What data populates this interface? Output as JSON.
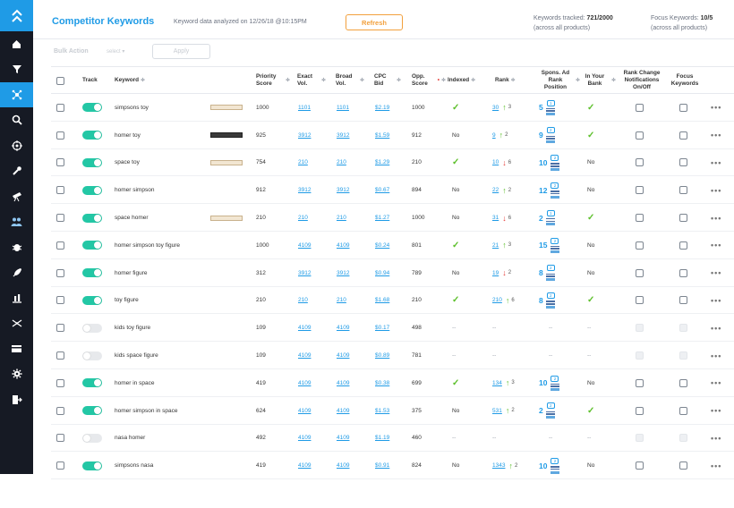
{
  "header": {
    "title": "Competitor Keywords",
    "analyzed": "Keyword data analyzed on 12/26/18 @10:15PM",
    "refresh_label": "Refresh",
    "tracked_label": "Keywords tracked:",
    "tracked_value": "721/2000",
    "tracked_sub": "(across all products)",
    "focus_label": "Focus Keywords:",
    "focus_value": "10/5",
    "focus_sub": "(across all products)"
  },
  "bulk": {
    "label": "Bulk Action",
    "select": "select ▾",
    "apply": "Apply"
  },
  "columns": {
    "track": "Track",
    "keyword": "Keyword",
    "priority": "Priority Score",
    "exact": "Exact Vol.",
    "broad": "Broad Vol.",
    "cpc": "CPC Bid",
    "opp": "Opp. Score",
    "indexed": "Indexed",
    "rank": "Rank",
    "spons": "Spons. Ad Rank Position",
    "bank": "In Your Bank",
    "notif": "Rank Change Notifications On/Off",
    "focus": "Focus Keywords"
  },
  "colors": {
    "accent": "#1f9be6",
    "toggle_on": "#23c7a5",
    "up": "#5cbf2a",
    "down": "#e53935",
    "refresh": "#f2a03d"
  },
  "rows": [
    {
      "track": true,
      "keyword": "simpsons toy",
      "thumb": "light",
      "priority": "1000",
      "exact": "1101",
      "broad": "1101",
      "cpc": "$2.19",
      "opp": "1000",
      "indexed": "check",
      "rank": "30",
      "dir": "up",
      "delta": "3",
      "spons": "5",
      "badge": "1",
      "bank": "check"
    },
    {
      "track": true,
      "keyword": "homer toy",
      "thumb": "dark",
      "priority": "925",
      "exact": "3912",
      "broad": "3912",
      "cpc": "$1.59",
      "opp": "912",
      "indexed": "No",
      "rank": "9",
      "dir": "up",
      "delta": "2",
      "spons": "9",
      "badge": "2",
      "bank": "check"
    },
    {
      "track": true,
      "keyword": "space toy",
      "thumb": "light",
      "priority": "754",
      "exact": "210",
      "broad": "210",
      "cpc": "$1.29",
      "opp": "210",
      "indexed": "check",
      "rank": "10",
      "dir": "down",
      "delta": "6",
      "spons": "10",
      "badge": "2",
      "bank": "No"
    },
    {
      "track": true,
      "keyword": "homer simpson",
      "thumb": "",
      "priority": "912",
      "exact": "3912",
      "broad": "3912",
      "cpc": "$0.67",
      "opp": "894",
      "indexed": "No",
      "rank": "22",
      "dir": "up",
      "delta": "2",
      "spons": "12",
      "badge": "2",
      "bank": "No"
    },
    {
      "track": true,
      "keyword": "space homer",
      "thumb": "light",
      "priority": "210",
      "exact": "210",
      "broad": "210",
      "cpc": "$1.27",
      "opp": "1000",
      "indexed": "No",
      "rank": "31",
      "dir": "down",
      "delta": "6",
      "spons": "2",
      "badge": "1",
      "bank": "check"
    },
    {
      "track": true,
      "keyword": "homer simpson toy figure",
      "thumb": "",
      "priority": "1000",
      "exact": "4109",
      "broad": "4109",
      "cpc": "$0.24",
      "opp": "801",
      "indexed": "check",
      "rank": "21",
      "dir": "up",
      "delta": "3",
      "spons": "15",
      "badge": "2",
      "bank": "No"
    },
    {
      "track": true,
      "keyword": "homer figure",
      "thumb": "",
      "priority": "312",
      "exact": "3912",
      "broad": "3912",
      "cpc": "$0.94",
      "opp": "789",
      "indexed": "No",
      "rank": "19",
      "dir": "down",
      "delta": "2",
      "spons": "8",
      "badge": "2",
      "bank": "No"
    },
    {
      "track": true,
      "keyword": "toy figure",
      "thumb": "",
      "priority": "210",
      "exact": "210",
      "broad": "210",
      "cpc": "$1.68",
      "opp": "210",
      "indexed": "check",
      "rank": "210",
      "dir": "up",
      "delta": "6",
      "spons": "8",
      "badge": "2",
      "bank": "check"
    },
    {
      "track": false,
      "keyword": "kids toy figure",
      "thumb": "",
      "priority": "109",
      "exact": "4109",
      "broad": "4109",
      "cpc": "$0.17",
      "opp": "498",
      "indexed": "--",
      "rank": "--",
      "dir": "",
      "delta": "",
      "spons": "--",
      "badge": "",
      "bank": "--"
    },
    {
      "track": false,
      "keyword": "kids space figure",
      "thumb": "",
      "priority": "109",
      "exact": "4109",
      "broad": "4109",
      "cpc": "$0.89",
      "opp": "781",
      "indexed": "--",
      "rank": "--",
      "dir": "",
      "delta": "",
      "spons": "--",
      "badge": "",
      "bank": "--"
    },
    {
      "track": true,
      "keyword": "homer in space",
      "thumb": "",
      "priority": "419",
      "exact": "4109",
      "broad": "4109",
      "cpc": "$0.38",
      "opp": "699",
      "indexed": "check",
      "rank": "134",
      "dir": "up",
      "delta": "3",
      "spons": "10",
      "badge": "2",
      "bank": "No"
    },
    {
      "track": true,
      "keyword": "homer simpson in space",
      "thumb": "",
      "priority": "624",
      "exact": "4109",
      "broad": "4109",
      "cpc": "$1.53",
      "opp": "375",
      "indexed": "No",
      "rank": "531",
      "dir": "up",
      "delta": "2",
      "spons": "2",
      "badge": "2",
      "bank": "check"
    },
    {
      "track": false,
      "keyword": "nasa homer",
      "thumb": "",
      "priority": "492",
      "exact": "4109",
      "broad": "4109",
      "cpc": "$1.19",
      "opp": "460",
      "indexed": "--",
      "rank": "--",
      "dir": "",
      "delta": "",
      "spons": "--",
      "badge": "",
      "bank": "--"
    },
    {
      "track": true,
      "keyword": "simpsons nasa",
      "thumb": "",
      "priority": "419",
      "exact": "4109",
      "broad": "4109",
      "cpc": "$0.91",
      "opp": "824",
      "indexed": "No",
      "rank": "1343",
      "dir": "up",
      "delta": "2",
      "spons": "10",
      "badge": "2",
      "bank": "No"
    }
  ],
  "sidebar": {
    "items": [
      "home-icon",
      "funnel-icon",
      "network-icon",
      "search-icon",
      "target-icon",
      "wrench-icon",
      "telescope-icon",
      "users-icon",
      "bug-icon",
      "rocket-icon",
      "chart-icon",
      "shuffle-icon",
      "card-icon",
      "gear-icon",
      "logout-icon"
    ]
  }
}
